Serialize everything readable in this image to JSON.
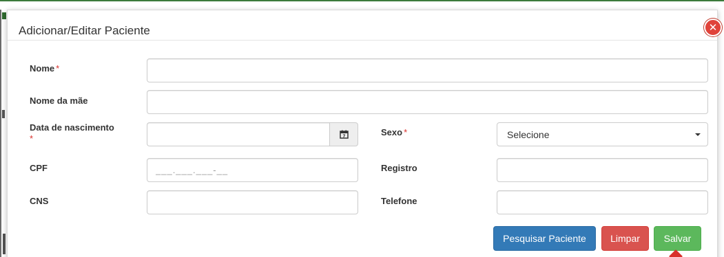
{
  "modal": {
    "title": "Adicionar/Editar Paciente",
    "close_icon": "close-icon"
  },
  "form": {
    "nome": {
      "label": "Nome",
      "required_mark": "*",
      "value": ""
    },
    "nome_mae": {
      "label": "Nome da mãe",
      "value": ""
    },
    "data_nascimento": {
      "label": "Data de nascimento",
      "required_mark": "*",
      "value": "",
      "icon": "calendar-icon"
    },
    "sexo": {
      "label": "Sexo",
      "required_mark": "*",
      "selected": "Selecione"
    },
    "cpf": {
      "label": "CPF",
      "placeholder": "___.___.___-__",
      "value": ""
    },
    "registro": {
      "label": "Registro",
      "value": ""
    },
    "cns": {
      "label": "CNS",
      "value": ""
    },
    "telefone": {
      "label": "Telefone",
      "value": ""
    }
  },
  "buttons": {
    "pesquisar": "Pesquisar Paciente",
    "limpar": "Limpar",
    "salvar": "Salvar"
  },
  "colors": {
    "primary": "#337ab7",
    "danger": "#d9534f",
    "success": "#5cb85c",
    "required": "#d9302c",
    "close": "#e0433a"
  }
}
